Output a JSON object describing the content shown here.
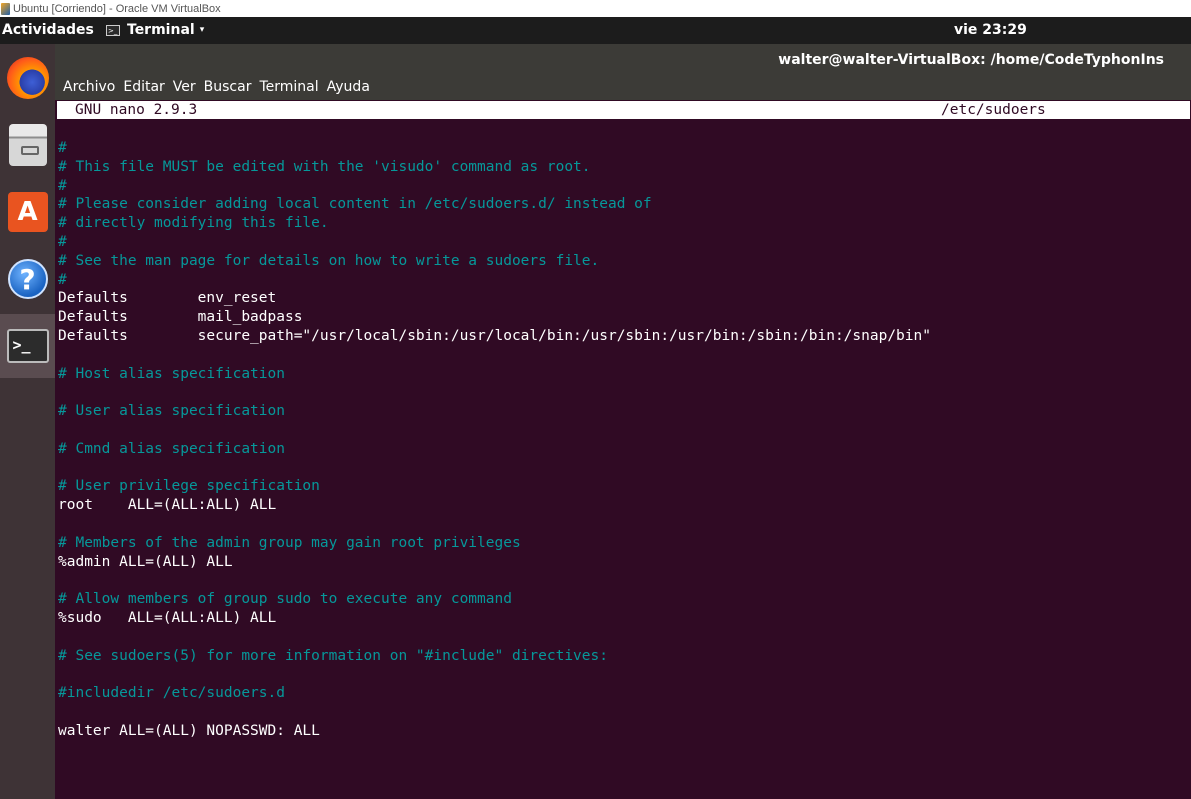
{
  "vbox": {
    "title": "Ubuntu [Corriendo] - Oracle VM VirtualBox"
  },
  "top_panel": {
    "activities": "Actividades",
    "app_name": "Terminal",
    "app_caret": "▾",
    "clock": "vie 23:29"
  },
  "dock": {
    "items": [
      "firefox-icon",
      "files-icon",
      "software-icon",
      "help-icon",
      "terminal-icon"
    ],
    "active": "terminal-icon"
  },
  "terminal": {
    "title": "walter@walter-VirtualBox: /home/CodeTyphonIns",
    "menu": [
      "Archivo",
      "Editar",
      "Ver",
      "Buscar",
      "Terminal",
      "Ayuda"
    ]
  },
  "nano": {
    "version": "GNU nano 2.9.3",
    "filename": "/etc/sudoers"
  },
  "colors": {
    "background": "#300a24",
    "comment": "#06989a",
    "text": "#ffffff",
    "panel": "#1c1c1c",
    "dock": "#3e3336"
  },
  "lines": [
    {
      "text": "#",
      "type": "comment"
    },
    {
      "text": "# This file MUST be edited with the 'visudo' command as root.",
      "type": "comment"
    },
    {
      "text": "#",
      "type": "comment"
    },
    {
      "text": "# Please consider adding local content in /etc/sudoers.d/ instead of",
      "type": "comment"
    },
    {
      "text": "# directly modifying this file.",
      "type": "comment"
    },
    {
      "text": "#",
      "type": "comment"
    },
    {
      "text": "# See the man page for details on how to write a sudoers file.",
      "type": "comment"
    },
    {
      "text": "#",
      "type": "comment"
    },
    {
      "text": "Defaults        env_reset",
      "type": "code"
    },
    {
      "text": "Defaults        mail_badpass",
      "type": "code"
    },
    {
      "text": "Defaults        secure_path=\"/usr/local/sbin:/usr/local/bin:/usr/sbin:/usr/bin:/sbin:/bin:/snap/bin\"",
      "type": "code"
    },
    {
      "text": "",
      "type": "code"
    },
    {
      "text": "# Host alias specification",
      "type": "comment"
    },
    {
      "text": "",
      "type": "code"
    },
    {
      "text": "# User alias specification",
      "type": "comment"
    },
    {
      "text": "",
      "type": "code"
    },
    {
      "text": "# Cmnd alias specification",
      "type": "comment"
    },
    {
      "text": "",
      "type": "code"
    },
    {
      "text": "# User privilege specification",
      "type": "comment"
    },
    {
      "text": "root    ALL=(ALL:ALL) ALL",
      "type": "code"
    },
    {
      "text": "",
      "type": "code"
    },
    {
      "text": "# Members of the admin group may gain root privileges",
      "type": "comment"
    },
    {
      "text": "%admin ALL=(ALL) ALL",
      "type": "code"
    },
    {
      "text": "",
      "type": "code"
    },
    {
      "text": "# Allow members of group sudo to execute any command",
      "type": "comment"
    },
    {
      "text": "%sudo   ALL=(ALL:ALL) ALL",
      "type": "code"
    },
    {
      "text": "",
      "type": "code"
    },
    {
      "text": "# See sudoers(5) for more information on \"#include\" directives:",
      "type": "comment"
    },
    {
      "text": "",
      "type": "code"
    },
    {
      "text": "#includedir /etc/sudoers.d",
      "type": "comment"
    },
    {
      "text": "",
      "type": "code"
    },
    {
      "text": "walter ALL=(ALL) NOPASSWD: ALL",
      "type": "code"
    }
  ]
}
